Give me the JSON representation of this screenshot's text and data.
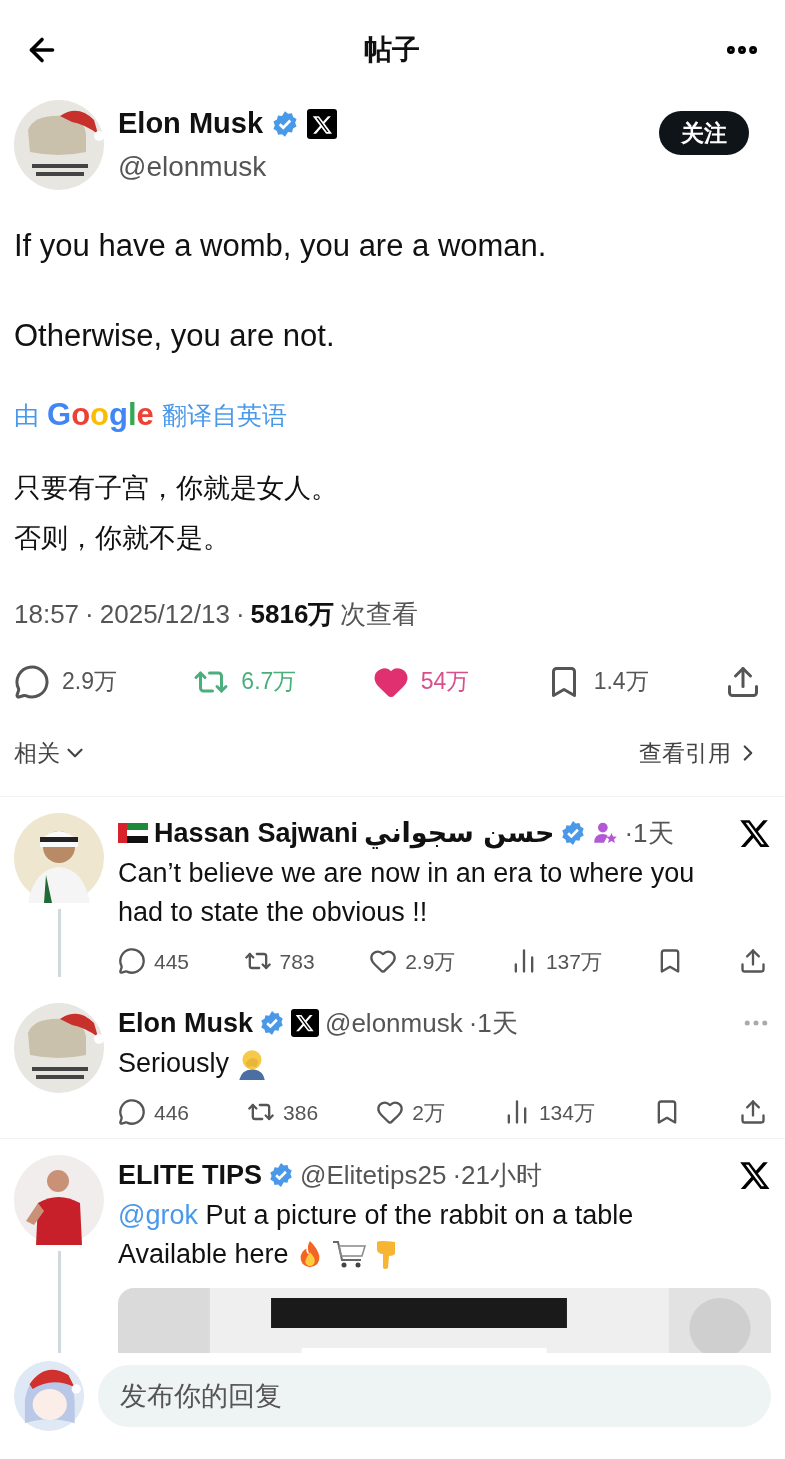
{
  "header": {
    "title": "帖子"
  },
  "post": {
    "author": {
      "name": "Elon Musk",
      "handle": "@elonmusk",
      "verified": true,
      "affiliate": true
    },
    "follow_button": "关注",
    "paragraphs": [
      "If you have a womb, you are a woman.",
      "Otherwise, you are not."
    ],
    "translation": {
      "prefix": "由",
      "provider": "Google",
      "suffix": "翻译自英语"
    },
    "translated": [
      "只要有子宫，你就是女人。",
      "否则，你就不是。"
    ],
    "meta": {
      "time": "18:57",
      "separator": "·",
      "date": "2025/12/13",
      "views": "5816万",
      "views_label": "次查看"
    },
    "actions": [
      {
        "kind": "reply",
        "count": "2.9万",
        "active": false
      },
      {
        "kind": "repost",
        "count": "6.7万",
        "active": true
      },
      {
        "kind": "like",
        "count": "54万",
        "active": true
      },
      {
        "kind": "bookmark",
        "count": "1.4万",
        "active": false
      },
      {
        "kind": "share"
      }
    ]
  },
  "related": {
    "label": "相关",
    "quotes_link": "查看引用"
  },
  "replies": [
    {
      "flag": true,
      "name": "Hassan Sajwani",
      "name_extra": "حسن سجواني",
      "verified": true,
      "affiliate": false,
      "subscriber": true,
      "time": "·1天",
      "menu": {
        "kind": "x"
      },
      "thread": true,
      "lines": [
        {
          "text": "Can’t believe we are now in an era to where you had to state the obvious !!"
        }
      ],
      "stats": [
        {
          "kind": "reply",
          "count": "445"
        },
        {
          "kind": "repost",
          "count": "783"
        },
        {
          "kind": "like",
          "count": "2.9万"
        },
        {
          "kind": "views",
          "count": "137万"
        },
        {
          "kind": "bookmark"
        },
        {
          "kind": "share"
        }
      ]
    },
    {
      "flag": false,
      "name": "Elon Musk",
      "verified": true,
      "affiliate": true,
      "subscriber": false,
      "handle": "@elonmusk",
      "time": "·1天",
      "menu": {
        "kind": "more"
      },
      "thread": false,
      "lines": [
        {
          "text": "Seriously",
          "emoji": [
            {
              "kind": "facepalm"
            }
          ]
        }
      ],
      "stats": [
        {
          "kind": "reply",
          "count": "446"
        },
        {
          "kind": "repost",
          "count": "386"
        },
        {
          "kind": "like",
          "count": "2万"
        },
        {
          "kind": "views",
          "count": "134万"
        },
        {
          "kind": "bookmark"
        },
        {
          "kind": "share"
        }
      ]
    },
    {
      "flag": false,
      "name": "ELITE TIPS",
      "verified": true,
      "affiliate": false,
      "subscriber": false,
      "handle": "@Elitetips25",
      "time": "·21小时",
      "menu": {
        "kind": "x"
      },
      "thread": true,
      "lines": [
        {
          "mention": "@grok",
          "text": " Put a picture of the rabbit on a table"
        },
        {
          "text": "Available here",
          "emoji": [
            {
              "kind": "fire"
            },
            {
              "kind": "cart"
            },
            {
              "kind": "point-down"
            }
          ]
        }
      ],
      "media": {
        "kind": "picture"
      }
    }
  ],
  "composer": {
    "placeholder": "发布你的回复"
  }
}
